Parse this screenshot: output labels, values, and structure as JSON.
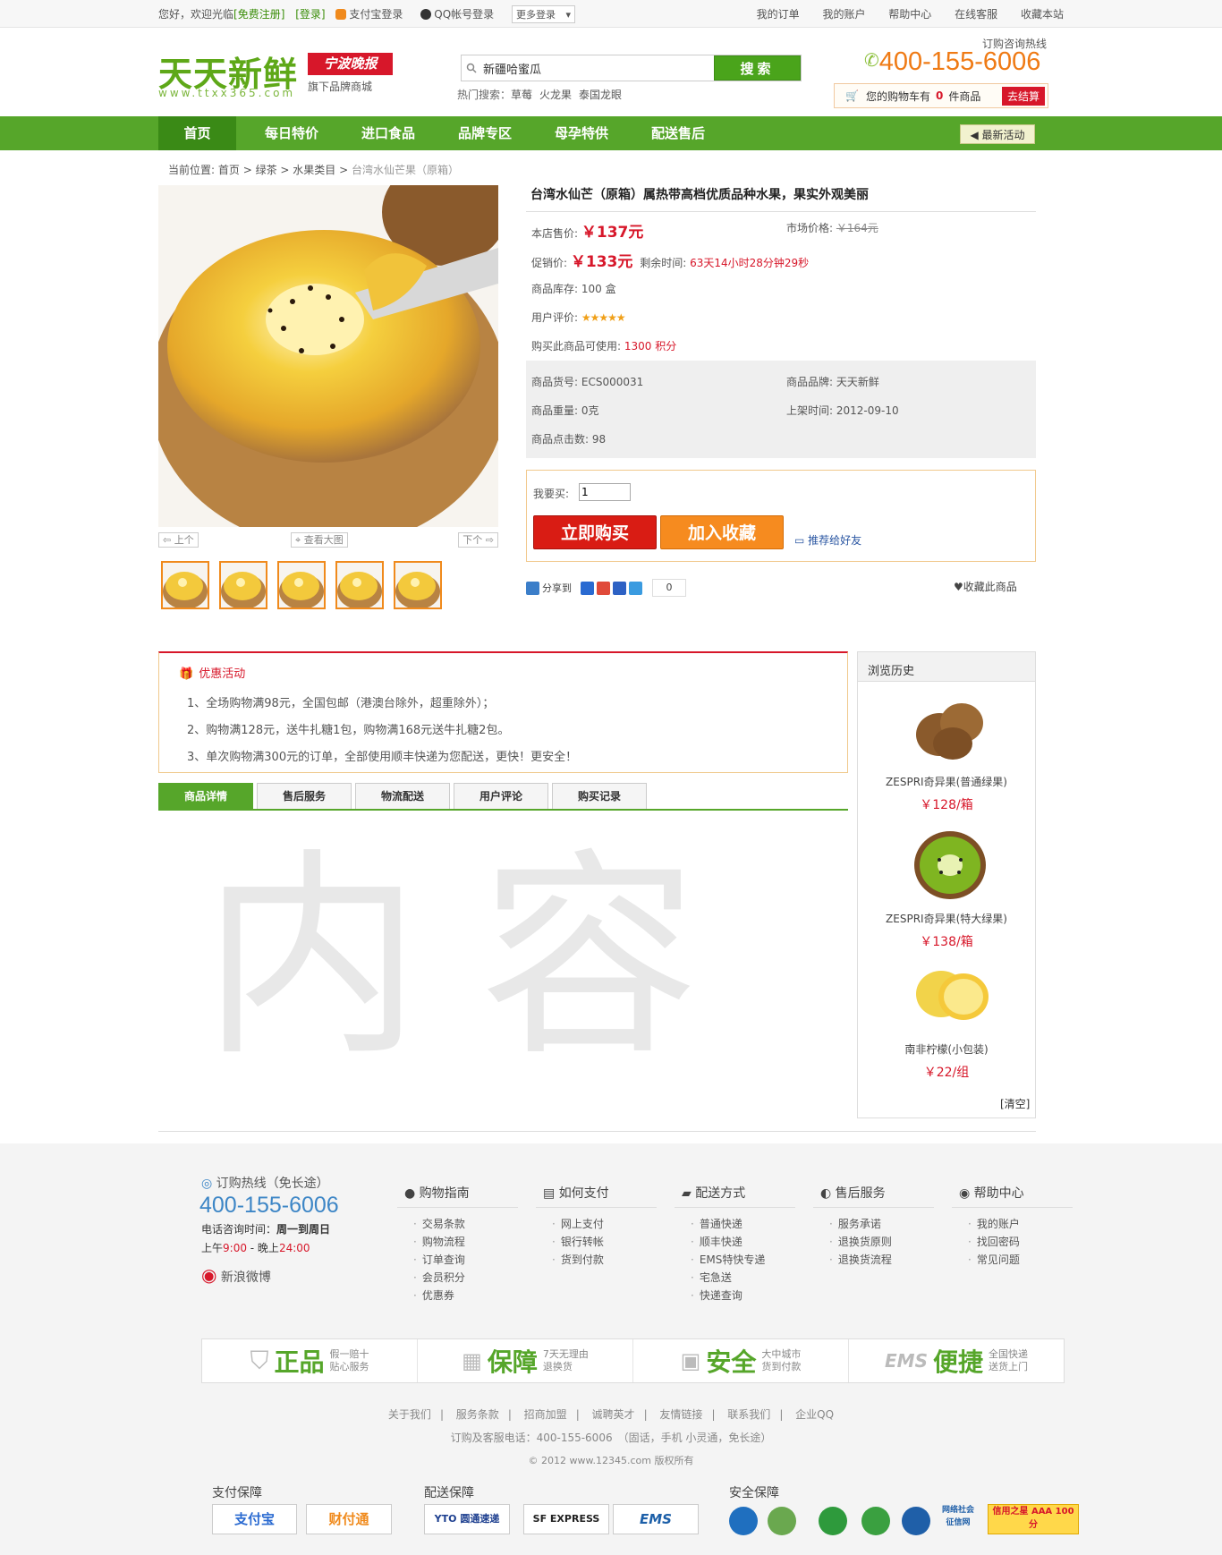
{
  "topbar": {
    "welcome": "您好，欢迎光临",
    "register": "[免费注册]",
    "login": "[登录]",
    "alipay_login": "支付宝登录",
    "qq_login": "QQ帐号登录",
    "more_login": "更多登录",
    "links": [
      "我的订单",
      "我的账户",
      "帮助中心",
      "在线客服",
      "收藏本站"
    ]
  },
  "header": {
    "logo_cn": "天天新鲜",
    "logo_en": "www.ttxx365.com",
    "seal": "宁波晚报",
    "sub": "旗下品牌商城",
    "search_value": "新疆哈蜜瓜",
    "search_btn": "搜索",
    "hot_label": "热门搜索：",
    "hot_items": [
      "草莓",
      "火龙果",
      "泰国龙眼"
    ],
    "hotline_label": "订购咨询热线",
    "hotline": "400-155-6006",
    "cart_text": "您的购物车有",
    "cart_count": "0",
    "cart_unit": "件商品",
    "checkout": "去结算"
  },
  "nav": {
    "items": [
      "首页",
      "每日特价",
      "进口食品",
      "品牌专区",
      "母孕特供",
      "配送售后"
    ],
    "activity": "最新活动"
  },
  "breadcrumb": {
    "prefix": "当前位置:",
    "items": [
      "首页",
      "绿茶",
      "水果类目"
    ],
    "current": "台湾水仙芒果（原箱）"
  },
  "gallery": {
    "prev": "上个",
    "view_large": "查看大图",
    "next": "下个"
  },
  "product": {
    "title": "台湾水仙芒（原箱）属热带高档优质品种水果，果实外观美丽",
    "shop_price_label": "本店售价:",
    "shop_price": "￥137元",
    "market_price_label": "市场价格:",
    "market_price": "￥164元",
    "promo_price_label": "促销价:",
    "promo_price": "￥133元",
    "remain_label": "剩余时间:",
    "remain": "63天14小时28分钟29秒",
    "stock_label": "商品库存:",
    "stock": "100 盒",
    "rating_label": "用户评价:",
    "rating_stars": "★★★★★",
    "rating_value": 5,
    "points_label": "购买此商品可使用:",
    "points": "1300 积分",
    "sku_label": "商品货号:",
    "sku": "ECS000031",
    "brand_label": "商品品牌:",
    "brand": "天天新鲜",
    "weight_label": "商品重量:",
    "weight": "0克",
    "date_label": "上架时间:",
    "date": "2012-09-10",
    "clicks_label": "商品点击数:",
    "clicks": "98",
    "qty_label": "我要买:",
    "qty": "1",
    "buy_now": "立即购买",
    "add_fav": "加入收藏",
    "recommend": "推荐给好友",
    "share": "分享到",
    "share_count": "0",
    "fav_link": "收藏此商品"
  },
  "promo": {
    "title": "优惠活动",
    "items": [
      "1、全场购物满98元，全国包邮（港澳台除外，超重除外）；",
      "2、购物满128元，送牛扎糖1包，购物满168元送牛扎糖2包。",
      "3、单次购物满300元的订单，全部使用顺丰快递为您配送，更快！更安全！"
    ]
  },
  "tabs": [
    "商品详情",
    "售后服务",
    "物流配送",
    "用户评论",
    "购买记录"
  ],
  "content_placeholder": "内容",
  "history": {
    "title": "浏览历史",
    "items": [
      {
        "name": "ZESPRI奇异果(普通绿果)",
        "price": "￥128/箱"
      },
      {
        "name": "ZESPRI奇异果(特大绿果)",
        "price": "￥138/箱"
      },
      {
        "name": "南非柠檬(小包装)",
        "price": "￥22/组"
      }
    ],
    "clear": "[清空]"
  },
  "footer": {
    "hotline_label": "订购热线（免长途）",
    "hotline": "400-155-6006",
    "time_label": "电话咨询时间：",
    "time_days": "周一到周日",
    "time_range_am": "上午",
    "time_am": "9:00",
    "time_sep": " - 晚上",
    "time_pm": "24:00",
    "weibo": "新浪微博",
    "columns": [
      {
        "title": "购物指南",
        "items": [
          "交易条款",
          "购物流程",
          "订单查询",
          "会员积分",
          "优惠券"
        ]
      },
      {
        "title": "如何支付",
        "items": [
          "网上支付",
          "银行转帐",
          "货到付款"
        ]
      },
      {
        "title": "配送方式",
        "items": [
          "普通快递",
          "顺丰快递",
          "EMS特快专递",
          "宅急送",
          "快递查询"
        ]
      },
      {
        "title": "售后服务",
        "items": [
          "服务承诺",
          "退换货原则",
          "退换货流程"
        ]
      },
      {
        "title": "帮助中心",
        "items": [
          "我的账户",
          "找回密码",
          "常见问题"
        ]
      }
    ],
    "guarantees": [
      {
        "big": "正品",
        "s1": "假一赔十",
        "s2": "贴心服务"
      },
      {
        "big": "保障",
        "s1": "7天无理由",
        "s2": "退换货"
      },
      {
        "big": "安全",
        "s1": "大中城市",
        "s2": "货到付款"
      },
      {
        "big": "便捷",
        "s1": "全国快递",
        "s2": "送货上门"
      }
    ],
    "links": [
      "关于我们",
      "服务条款",
      "招商加盟",
      "诚聘英才",
      "友情链接",
      "联系我们",
      "企业QQ"
    ],
    "contact": "订购及客服电话：400-155-6006　（固话，手机 小灵通，免长途）",
    "copyright": "© 2012 www.12345.com 版权所有",
    "pay_label": "支付保障",
    "ship_label": "配送保障",
    "safe_label": "安全保障",
    "pay_logos": [
      "支付宝",
      "财付通"
    ],
    "ship_logos": [
      "YTO 圆通速递",
      "SF EXPRESS",
      "EMS"
    ],
    "safe_text1": "网络社会 征信网",
    "safe_text2": "信用之星 AAA 100分"
  },
  "colors": {
    "brand_green": "#56a62a",
    "price_red": "#d7172a",
    "orange": "#f68b1f",
    "hotline_orange": "#ef7a14"
  }
}
